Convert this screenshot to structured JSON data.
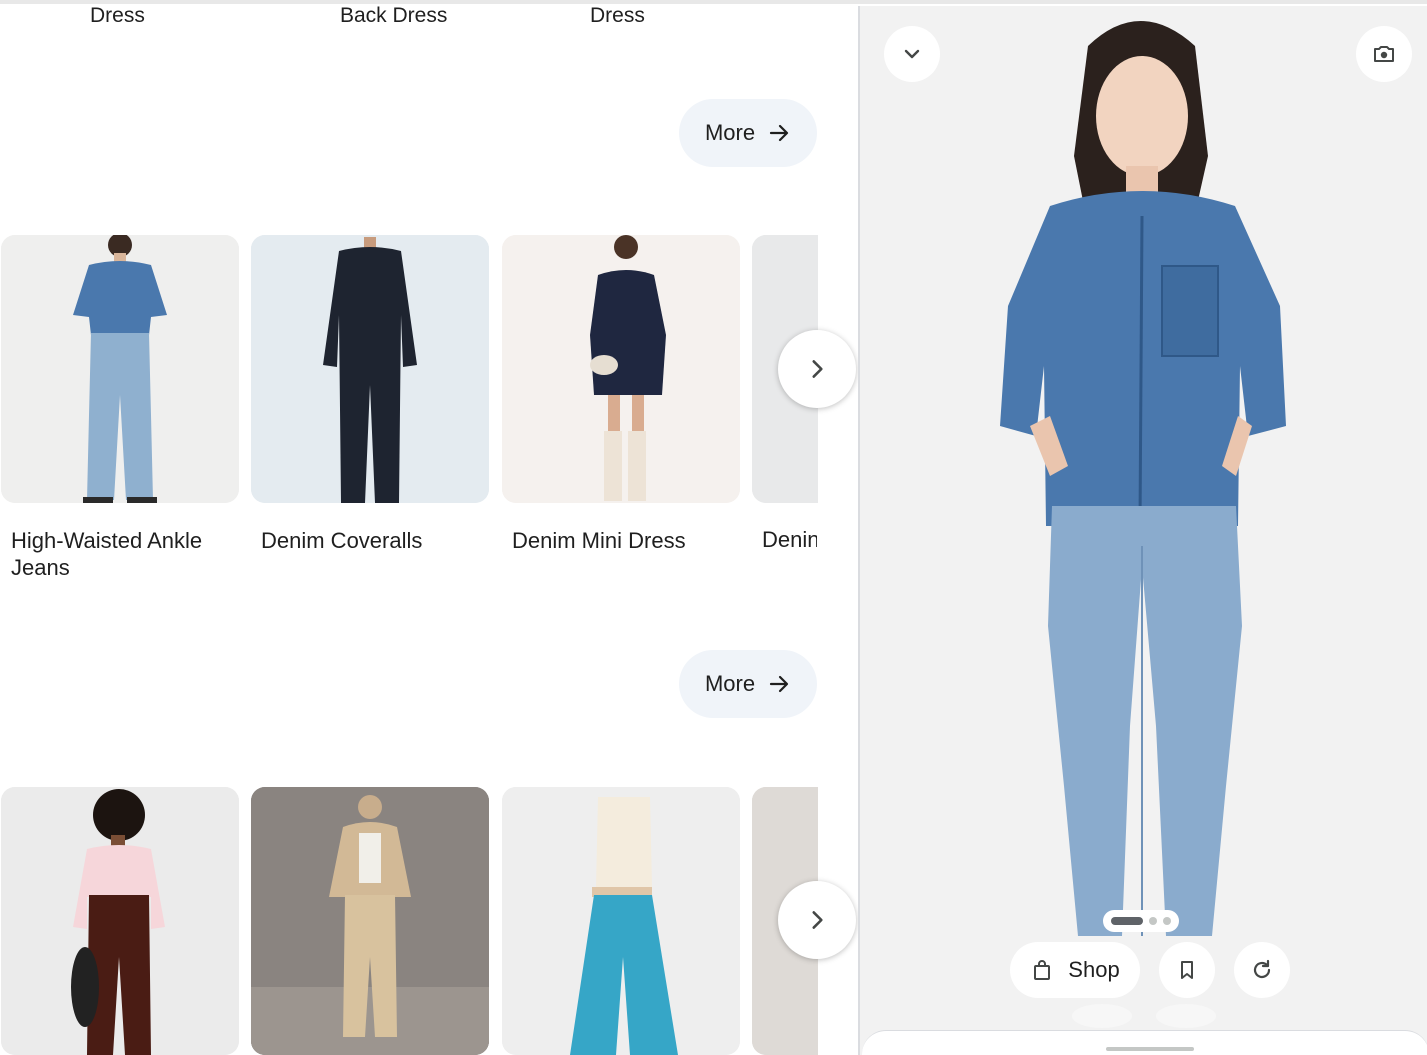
{
  "top_row": {
    "labels": [
      "Dress",
      "Back Dress",
      "Dress"
    ]
  },
  "section1": {
    "more_label": "More",
    "cards": [
      {
        "title": "High-Waisted Ankle Jeans"
      },
      {
        "title": "Denim Coveralls"
      },
      {
        "title": "Denim Mini Dress"
      },
      {
        "title": "Denin"
      }
    ]
  },
  "section2": {
    "more_label": "More"
  },
  "panel": {
    "shop_label": "Shop",
    "carousel": {
      "current": 1,
      "total": 3
    }
  },
  "colors": {
    "more_button_bg": "#f0f4f9",
    "panel_bg": "#f2f2f2",
    "denim": "#4a78ad",
    "text": "#1f1f1f"
  }
}
